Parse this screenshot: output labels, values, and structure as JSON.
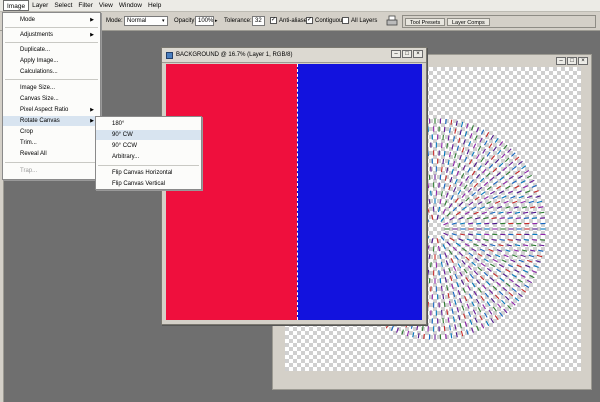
{
  "menubar": {
    "items": [
      "Image",
      "Layer",
      "Select",
      "Filter",
      "View",
      "Window",
      "Help"
    ],
    "active": "Image"
  },
  "options": {
    "mode_label": "Mode:",
    "mode_value": "Normal",
    "opacity_label": "Opacity:",
    "opacity_value": "100%",
    "tolerance_label": "Tolerance:",
    "tolerance_value": "32",
    "antialiased_label": "Anti-aliased",
    "contiguous_label": "Contiguous",
    "all_layers_label": "All Layers",
    "tabs": [
      "Tool Presets",
      "Layer Comps"
    ]
  },
  "document": {
    "title": "BACKGROUND @ 16.7% (Layer 1, RGB/8)"
  },
  "image_menu": {
    "items": [
      "Mode",
      "Adjustments",
      "Duplicate...",
      "Apply Image...",
      "Calculations...",
      "Image Size...",
      "Canvas Size...",
      "Pixel Aspect Ratio",
      "Rotate Canvas",
      "Crop",
      "Trim...",
      "Reveal All",
      "Trap..."
    ]
  },
  "rotate_menu": {
    "items": [
      "180°",
      "90° CW",
      "90° CCW",
      "Arbitrary...",
      "Flip Canvas Horizontal",
      "Flip Canvas Vertical"
    ]
  },
  "colors": {
    "red_fill": "#ef0f3d",
    "blue_fill": "#1212de",
    "menu_highlight": "#d8e4f0"
  }
}
